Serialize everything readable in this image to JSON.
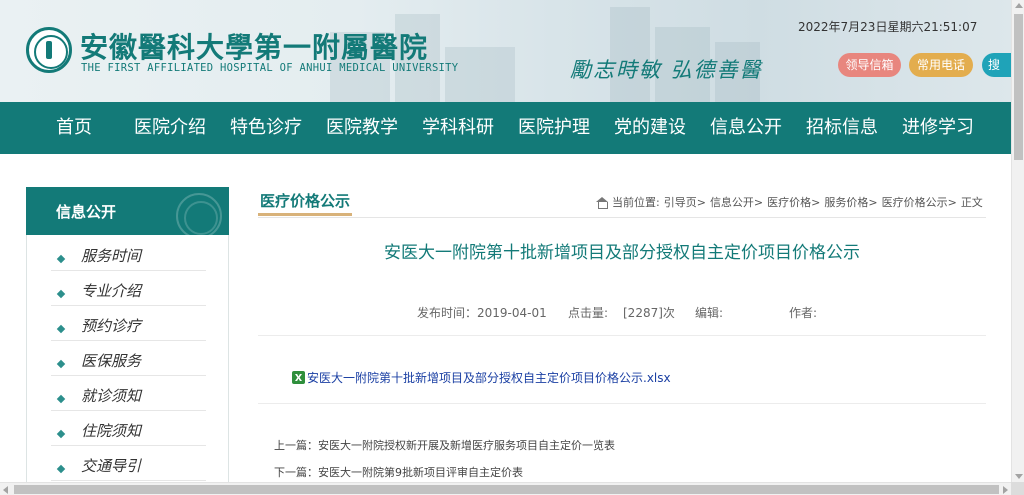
{
  "header": {
    "logo_cn": "安徽醫科大學第一附屬醫院",
    "logo_en": "THE FIRST AFFILIATED HOSPITAL OF ANHUI MEDICAL UNIVERSITY",
    "motto": "勵志時敏  弘德善醫",
    "datetime": "2022年7月23日星期六21:51:07",
    "buttons": [
      "领导信箱",
      "常用电话",
      "搜"
    ]
  },
  "nav": {
    "items": [
      "首页",
      "医院介绍",
      "特色诊疗",
      "医院教学",
      "学科科研",
      "医院护理",
      "党的建设",
      "信息公开",
      "招标信息",
      "进修学习"
    ]
  },
  "sidebar": {
    "title": "信息公开",
    "items": [
      "服务时间",
      "专业介绍",
      "预约诊疗",
      "医保服务",
      "就诊须知",
      "住院须知",
      "交通导引"
    ]
  },
  "main": {
    "tab": "医疗价格公示",
    "breadcrumb": {
      "prefix": "当前位置:",
      "items": [
        "引导页>",
        "信息公开>",
        "医疗价格>",
        "服务价格>",
        "医疗价格公示>",
        "正文"
      ]
    },
    "title": "安医大一附院第十批新增项目及部分授权自主定价项目价格公示",
    "meta": {
      "publish": "发布时间：2019-04-01",
      "clicks_label": "点击量:",
      "clicks_value": "[2287]次",
      "editor": "编辑:",
      "author": "作者:"
    },
    "attachment": "安医大一附院第十批新增项目及部分授权自主定价项目价格公示.xlsx",
    "prev": "上一篇：安医大一附院授权新开展及新增医疗服务项目自主定价一览表",
    "next": "下一篇：安医大一附院第9批新项目评审自主定价表"
  },
  "colors": {
    "brand": "#137a78",
    "accent_tab": "#d8b27a",
    "btn_mailbox": "#e8867e",
    "btn_phone": "#e3ad4e",
    "btn_search": "#1fa3b8",
    "link": "#1a3fa3"
  }
}
